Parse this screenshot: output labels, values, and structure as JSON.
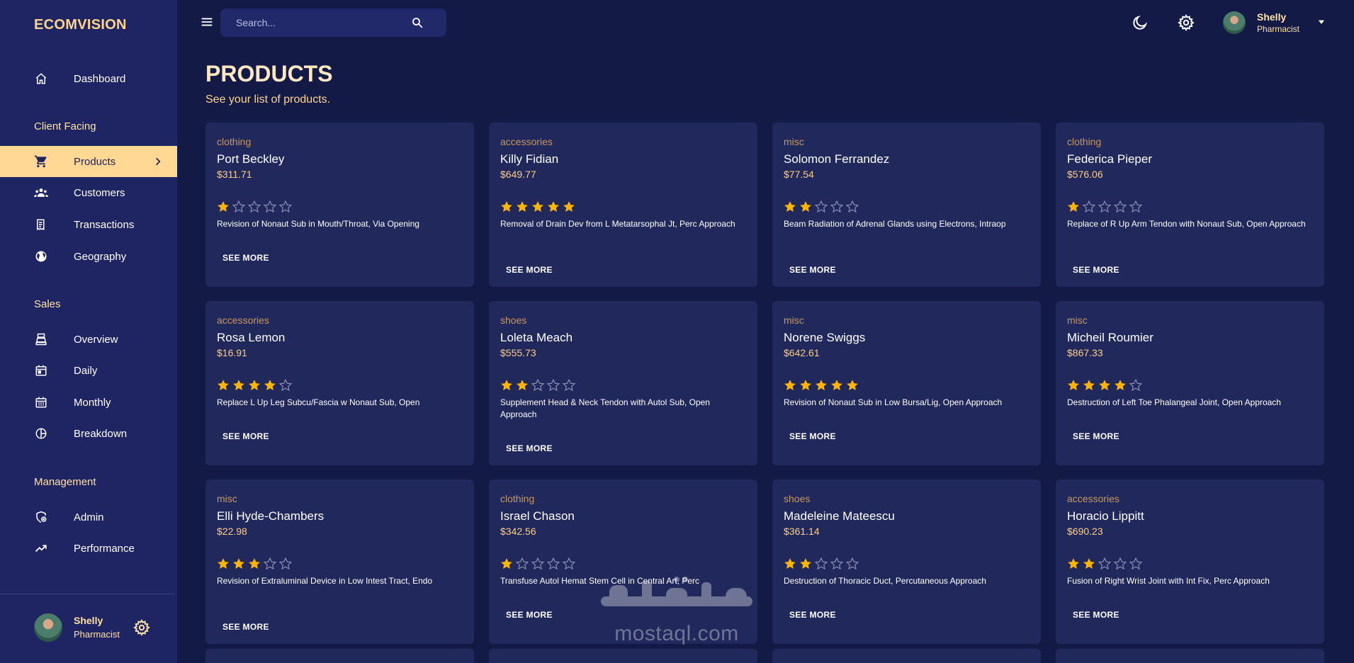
{
  "brand": "ECOMVISION",
  "search": {
    "placeholder": "Search..."
  },
  "user": {
    "name": "Shelly",
    "role": "Pharmacist"
  },
  "sidebar": {
    "items": [
      {
        "key": "dashboard",
        "label": "Dashboard",
        "icon": "home-icon"
      },
      {
        "key": "products",
        "label": "Products",
        "icon": "cart-icon",
        "active": true
      },
      {
        "key": "customers",
        "label": "Customers",
        "icon": "users-icon"
      },
      {
        "key": "transactions",
        "label": "Transactions",
        "icon": "receipt-icon"
      },
      {
        "key": "geography",
        "label": "Geography",
        "icon": "globe-icon"
      },
      {
        "key": "overview",
        "label": "Overview",
        "icon": "point-of-sale-icon"
      },
      {
        "key": "daily",
        "label": "Daily",
        "icon": "calendar-today-icon"
      },
      {
        "key": "monthly",
        "label": "Monthly",
        "icon": "calendar-month-icon"
      },
      {
        "key": "breakdown",
        "label": "Breakdown",
        "icon": "pie-chart-icon"
      },
      {
        "key": "admin",
        "label": "Admin",
        "icon": "admin-icon"
      },
      {
        "key": "performance",
        "label": "Performance",
        "icon": "trending-up-icon"
      }
    ],
    "sections": [
      "Client Facing",
      "Sales",
      "Management"
    ]
  },
  "page": {
    "title": "PRODUCTS",
    "subtitle": "See your list of products."
  },
  "see_more_label": "SEE MORE",
  "products": [
    {
      "category": "clothing",
      "name": "Port Beckley",
      "price": "$311.71",
      "rating": 1,
      "description": "Revision of Nonaut Sub in Mouth/Throat, Via Opening"
    },
    {
      "category": "accessories",
      "name": "Killy Fidian",
      "price": "$649.77",
      "rating": 5,
      "description": "Removal of Drain Dev from L Metatarsophal Jt, Perc Approach"
    },
    {
      "category": "misc",
      "name": "Solomon Ferrandez",
      "price": "$77.54",
      "rating": 2,
      "description": "Beam Radiation of Adrenal Glands using Electrons, Intraop"
    },
    {
      "category": "clothing",
      "name": "Federica Pieper",
      "price": "$576.06",
      "rating": 1,
      "description": "Replace of R Up Arm Tendon with Nonaut Sub, Open Approach"
    },
    {
      "category": "accessories",
      "name": "Rosa Lemon",
      "price": "$16.91",
      "rating": 4,
      "description": "Replace L Up Leg Subcu/Fascia w Nonaut Sub, Open"
    },
    {
      "category": "shoes",
      "name": "Loleta Meach",
      "price": "$555.73",
      "rating": 2,
      "description": "Supplement Head & Neck Tendon with Autol Sub, Open Approach"
    },
    {
      "category": "misc",
      "name": "Norene Swiggs",
      "price": "$642.61",
      "rating": 5,
      "description": "Revision of Nonaut Sub in Low Bursa/Lig, Open Approach"
    },
    {
      "category": "misc",
      "name": "Micheil Roumier",
      "price": "$867.33",
      "rating": 4,
      "description": "Destruction of Left Toe Phalangeal Joint, Open Approach"
    },
    {
      "category": "misc",
      "name": "Elli Hyde-Chambers",
      "price": "$22.98",
      "rating": 3,
      "description": "Revision of Extraluminal Device in Low Intest Tract, Endo"
    },
    {
      "category": "clothing",
      "name": "Israel Chason",
      "price": "$342.56",
      "rating": 1,
      "description": "Transfuse Autol Hemat Stem Cell in Central Art, Perc"
    },
    {
      "category": "shoes",
      "name": "Madeleine Mateescu",
      "price": "$361.14",
      "rating": 2,
      "description": "Destruction of Thoracic Duct, Percutaneous Approach"
    },
    {
      "category": "accessories",
      "name": "Horacio Lippitt",
      "price": "$690.23",
      "rating": 2,
      "description": "Fusion of Right Wrist Joint with Int Fix, Perc Approach"
    }
  ],
  "watermark": {
    "text": "mostaql.com",
    "logo_text": "مستقل"
  },
  "colors": {
    "accent": "#ffd993",
    "star": "#ffb400",
    "background": "#141a46",
    "sidebar": "#1f2463",
    "card": "#21295c"
  }
}
